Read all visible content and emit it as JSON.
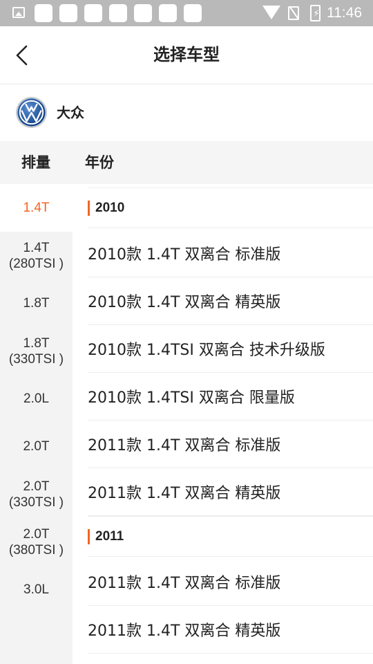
{
  "status_bar": {
    "time": "11:46",
    "battery_glyph": "⚡"
  },
  "header": {
    "title": "选择车型",
    "back_icon": "chevron-left-icon"
  },
  "brand": {
    "name": "大众",
    "logo_icon": "volkswagen-logo"
  },
  "columns": {
    "displacement": "排量",
    "year": "年份"
  },
  "displacements": [
    {
      "line1": "1.4T",
      "line2": ""
    },
    {
      "line1": "1.4T",
      "line2": "(280TSI )"
    },
    {
      "line1": "1.8T",
      "line2": ""
    },
    {
      "line1": "1.8T",
      "line2": "(330TSI )"
    },
    {
      "line1": "2.0L",
      "line2": ""
    },
    {
      "line1": "2.0T",
      "line2": ""
    },
    {
      "line1": "2.0T",
      "line2": "(330TSI )"
    },
    {
      "line1": "2.0T",
      "line2": "(380TSI )"
    },
    {
      "line1": "3.0L",
      "line2": ""
    }
  ],
  "selected_displacement": "1.4T",
  "groups": [
    {
      "year": "2010",
      "models": [
        "2010款 1.4T 双离合 标准版",
        "2010款 1.4T 双离合 精英版",
        "2010款 1.4TSI 双离合 技术升级版",
        "2010款 1.4TSI 双离合 限量版",
        "2011款 1.4T 双离合 标准版",
        "2011款 1.4T 双离合 精英版"
      ]
    },
    {
      "year": "2011",
      "models": [
        "2011款 1.4T 双离合 标准版",
        "2011款 1.4T 双离合 精英版"
      ]
    }
  ],
  "colors": {
    "accent": "#f26522",
    "status_bar": "#b9b9b9",
    "side_bg": "#f3f3f3"
  }
}
